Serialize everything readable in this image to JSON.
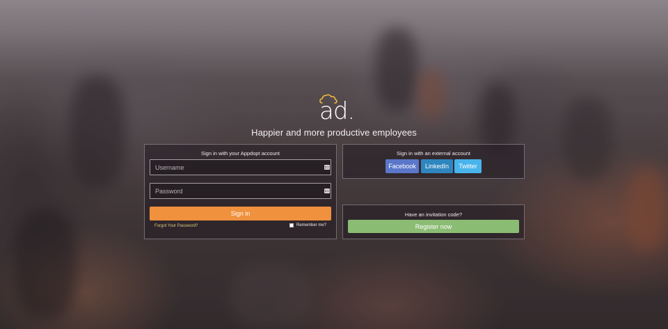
{
  "brand": {
    "logo_text": "ad.",
    "tagline": "Happier and more productive employees"
  },
  "login": {
    "title": "Sign in with your Appdopt account",
    "username_placeholder": "Username",
    "password_placeholder": "Password",
    "signin_label": "Sign in",
    "forgot_label": "Forgot Your Password?",
    "remember_label": "Remember me?"
  },
  "external": {
    "title": "Sign in with an external account",
    "providers": [
      "Facebook",
      "LinkedIn",
      "Twitter"
    ]
  },
  "invite": {
    "title": "Have an invitation code?",
    "register_label": "Register now"
  },
  "colors": {
    "signin": "#f0913e",
    "facebook": "#5b77c9",
    "linkedin": "#2f86bf",
    "twitter": "#49b4ec",
    "register": "#8bbc74",
    "logo_cloud": "#f0b840"
  }
}
